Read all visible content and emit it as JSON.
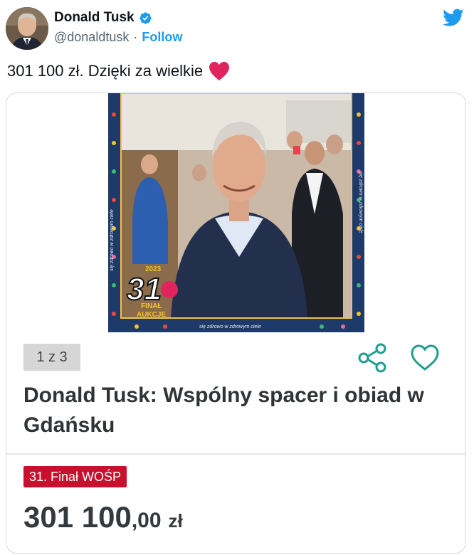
{
  "author": {
    "name": "Donald Tusk",
    "handle": "@donaldtusk",
    "separator": "·",
    "follow_label": "Follow"
  },
  "tweet": {
    "text": "301 100 zł. Dzięki za wielkie"
  },
  "auction": {
    "image_counter": "1 z 3",
    "title": "Donald Tusk: Wspólny spacer i obiad w Gdańsku",
    "badge": "31. Finał WOŚP",
    "price_main": "301 100",
    "price_cents": ",00",
    "price_currency": "zł",
    "image_logo_number": "31",
    "image_logo_year": "2023",
    "image_logo_line1": "FINAŁ",
    "image_logo_line2": "AUKCJE",
    "image_frame_text": "się zdrowo w zdrowym ciele",
    "image_frame_text_side": "się zdrowo w zdrowym ciele",
    "image_frame_text_right": "się zdrowo w zdrowym ciele"
  },
  "colors": {
    "accent_blue": "#1d9bf0",
    "badge_red": "#c8102e",
    "icon_teal": "#1f9e8e",
    "heart_red": "#e0245e"
  },
  "icons": {
    "verified": "verified-badge-icon",
    "bird": "twitter-bird-icon",
    "heart": "red-heart-emoji-icon",
    "share": "share-icon",
    "favorite": "heart-outline-icon"
  }
}
